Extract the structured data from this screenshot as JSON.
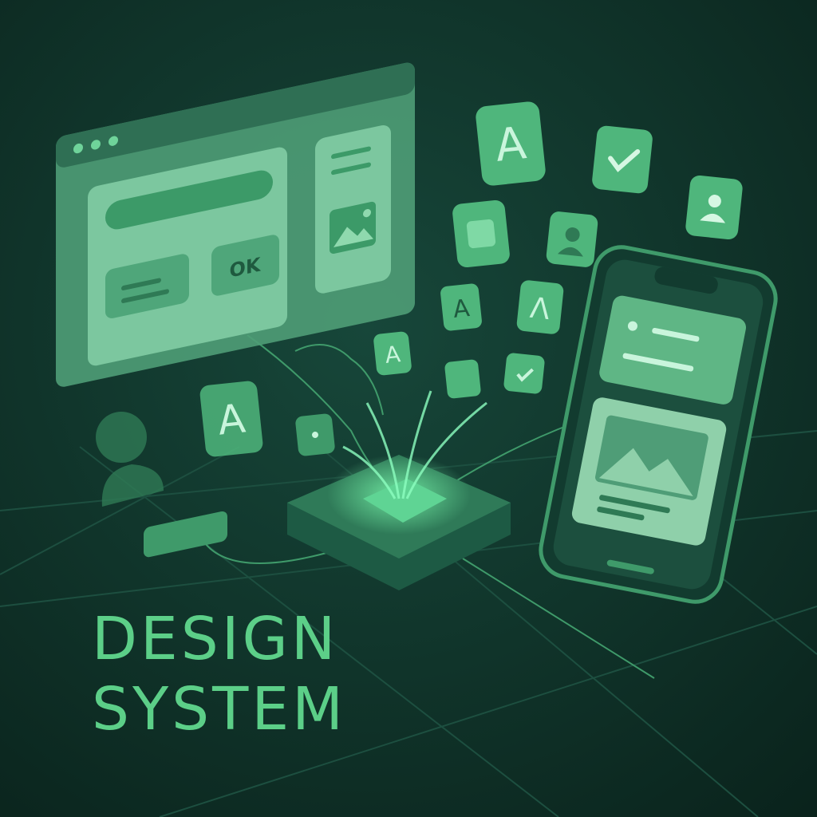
{
  "colors": {
    "background": "#0b2820",
    "accent": "#4fc27f",
    "panel": "#6fbf93",
    "title_text": "#5ccf88"
  },
  "browser_window": {
    "ok_button_label": "OK",
    "icons": [
      "window-dots-icon",
      "image-icon"
    ]
  },
  "floating_tiles": [
    {
      "icon": "letter-a-icon",
      "label": "A"
    },
    {
      "icon": "check-icon"
    },
    {
      "icon": "user-icon"
    },
    {
      "icon": "square-icon"
    },
    {
      "icon": "user-icon"
    },
    {
      "icon": "letter-a-icon",
      "label": "A"
    },
    {
      "icon": "letter-a-icon",
      "label": "Λ"
    },
    {
      "icon": "letter-a-icon",
      "label": "A"
    },
    {
      "icon": "square-icon"
    },
    {
      "icon": "check-icon"
    },
    {
      "icon": "letter-a-icon",
      "label": "A"
    },
    {
      "icon": "dot-icon"
    }
  ],
  "heading": {
    "line1": "DESIGN",
    "line2": "SYSTEM"
  }
}
